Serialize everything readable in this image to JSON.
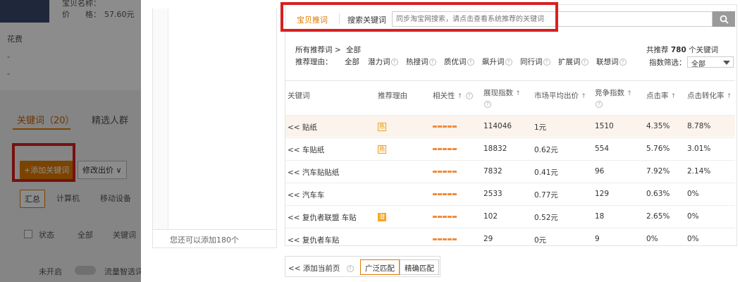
{
  "background": {
    "product_name_prefix": "宝贝名称：",
    "price_label": "价　　格：",
    "price_value": "57.60元",
    "spend_label": "花费",
    "dash1": "-",
    "dash2": "-",
    "tabs": [
      "关键词（20）",
      "精选人群"
    ],
    "add_keyword_button": "+添加关键词",
    "modify_bid_button": "修改出价",
    "device_tabs": [
      "汇总",
      "计算机",
      "移动设备"
    ],
    "filter_status": "状态",
    "filter_all": "全部",
    "filter_keyword": "关键词",
    "row_status": "未开启",
    "row_label": "流量智选词"
  },
  "modal": {
    "left_footer": "您还可以添加180个",
    "search": {
      "tab_recommend": "宝贝推词",
      "tab_search": "搜索关键词",
      "placeholder": "同步淘宝网搜索，请点击查看系统推荐的关键词"
    },
    "filters": {
      "all_words_label": "所有推荐词 >",
      "all_words_value": "全部",
      "reason_label": "推荐理由：",
      "reasons": [
        "全部",
        "潜力词",
        "热搜词",
        "质优词",
        "飙升词",
        "同行词",
        "扩展词",
        "联想词"
      ],
      "total_prefix": "共推荐",
      "total_count": "780",
      "total_suffix": "个关键词",
      "index_filter_label": "指数筛选：",
      "index_filter_value": "全部"
    },
    "table": {
      "headers": {
        "keyword": "关键词",
        "reason": "推荐理由",
        "relevance": "相关性",
        "impressions": "展现指数",
        "avg_bid": "市场平均出价",
        "competition": "竞争指数",
        "ctr": "点击率",
        "cvr": "点击转化率"
      },
      "rows": [
        {
          "keyword": "<< 贴纸",
          "badge": "热",
          "impressions": "114046",
          "avg_bid": "1元",
          "competition": "1510",
          "ctr": "4.35%",
          "cvr": "8.78%"
        },
        {
          "keyword": "<< 车贴纸",
          "badge": "热",
          "impressions": "18832",
          "avg_bid": "0.62元",
          "competition": "554",
          "ctr": "5.76%",
          "cvr": "3.01%"
        },
        {
          "keyword": "<< 汽车贴贴纸",
          "badge": "",
          "impressions": "7832",
          "avg_bid": "0.41元",
          "competition": "96",
          "ctr": "7.92%",
          "cvr": "2.14%"
        },
        {
          "keyword": "<< 汽车车",
          "badge": "",
          "impressions": "2533",
          "avg_bid": "0.77元",
          "competition": "129",
          "ctr": "0.63%",
          "cvr": "0%"
        },
        {
          "keyword": "<< 复仇者联盟 车贴",
          "badge": "潜",
          "impressions": "102",
          "avg_bid": "0.52元",
          "competition": "18",
          "ctr": "2.65%",
          "cvr": "0%"
        },
        {
          "keyword": "<< 复仇者车贴",
          "badge": "",
          "impressions": "29",
          "avg_bid": "0元",
          "competition": "9",
          "ctr": "0%",
          "cvr": "0%"
        }
      ]
    },
    "bottom": {
      "add_page": "<< 添加当前页",
      "broad_match": "广泛匹配",
      "exact_match": "精确匹配"
    }
  },
  "colors": {
    "accent_orange": "#e07a00",
    "highlight_red": "#d9201e",
    "bar_orange": "#f08c3c"
  }
}
